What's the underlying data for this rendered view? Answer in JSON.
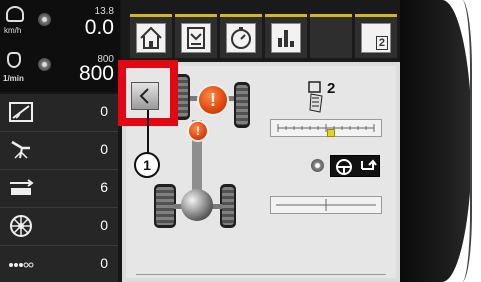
{
  "status": {
    "speed": {
      "value": "0.0",
      "max": "13.8",
      "unit": "km/h"
    },
    "rpm": {
      "value": "800",
      "max": "800",
      "unit": "1/min"
    }
  },
  "sidebar": {
    "rows": [
      {
        "icon": "slope-icon",
        "value": "0"
      },
      {
        "icon": "implement-lift-icon",
        "value": "0"
      },
      {
        "icon": "width-arrows-icon",
        "value": "6"
      },
      {
        "icon": "wheel-icon",
        "value": "0"
      },
      {
        "icon": "dots-icon",
        "value": "0"
      }
    ]
  },
  "tabs": [
    {
      "icon": "home-icon"
    },
    {
      "icon": "book-icon"
    },
    {
      "icon": "stopwatch-icon"
    },
    {
      "icon": "bar-chart-icon"
    },
    {
      "icon": "empty-tab"
    },
    {
      "icon": "page-2-icon",
      "label": "2"
    }
  ],
  "main": {
    "back_icon": "chevron-left-icon",
    "remote_number": "2",
    "callout_number": "1",
    "slider_marker_fraction": 0.55,
    "highlight_color": "#e30613",
    "warning_color": "#e24a10",
    "accent_color": "#d3b51d"
  }
}
